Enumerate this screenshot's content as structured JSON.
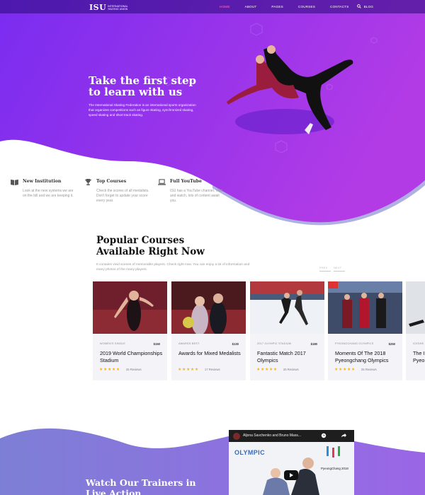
{
  "brand": {
    "mark": "ISU",
    "sub": "International Skating Union"
  },
  "nav": {
    "items": [
      "HOME",
      "ABOUT",
      "PAGES",
      "COURSES",
      "CONTACTS",
      "BLOG"
    ],
    "active": "HOME",
    "search_icon": "search-icon"
  },
  "hero": {
    "title": "Take the first step to learn with us",
    "text": "The International Skating Federation is an international sports organization that organizes competitions such as figure skating, synchronized skating, speed skating and short track skating."
  },
  "features": [
    {
      "icon": "book-icon",
      "title": "New Institution",
      "text": "Look at the new systems we are on the bill and we are keeping it."
    },
    {
      "icon": "trophy-icon",
      "title": "Top Courses",
      "text": "Check the scores of all medalists. Don't forget to update your score every year."
    },
    {
      "icon": "laptop-icon",
      "title": "Full YouTube",
      "text": "ISU has a YouTube channel. Visit and watch, lots of content await you."
    }
  ],
  "courses": {
    "title": "Popular Courses Available Right Now",
    "text": "It contains vivid scenes of memorable players. Check right now. You can enjoy a lot of information and many photos of the many players.",
    "prev": "PREV",
    "next": "NEXT",
    "cards": [
      {
        "category": "WOMEN'S SINGLE",
        "price": "$150",
        "title": "2019 World Championships Stadium",
        "stars": "★★★★★",
        "reviews": "25 Reviews"
      },
      {
        "category": "AWARDS BEST",
        "price": "$130",
        "title": "Awards for Mixed Medalists",
        "stars": "★★★★★",
        "reviews": "17 Reviews"
      },
      {
        "category": "2017 OLYMPIC STADIUM",
        "price": "$180",
        "title": "Fantastic Match 2017 Olympics",
        "stars": "★★★★★",
        "reviews": "25 Reviews"
      },
      {
        "category": "PYEONGCHANG OLYMPICS",
        "price": "$250",
        "title": "Moments Of The 2018 Pyeongchang Olympics",
        "stars": "★★★★★",
        "reviews": "25 Reviews"
      },
      {
        "category": "ICESHE",
        "price": "",
        "title": "The I Pyeo",
        "stars": "",
        "reviews": ""
      }
    ]
  },
  "trainers": {
    "title": "Watch Our Trainers in Live Action",
    "video_title": "Aljona Savchenko and Bruno Mass...",
    "video_brand": "OLYMPIC",
    "video_event": "PyeongChang 2018"
  },
  "colors": {
    "hero_from": "#7a2cf0",
    "hero_to": "#b23be6",
    "accent": "#ff6fd0",
    "star": "#f6b817"
  }
}
